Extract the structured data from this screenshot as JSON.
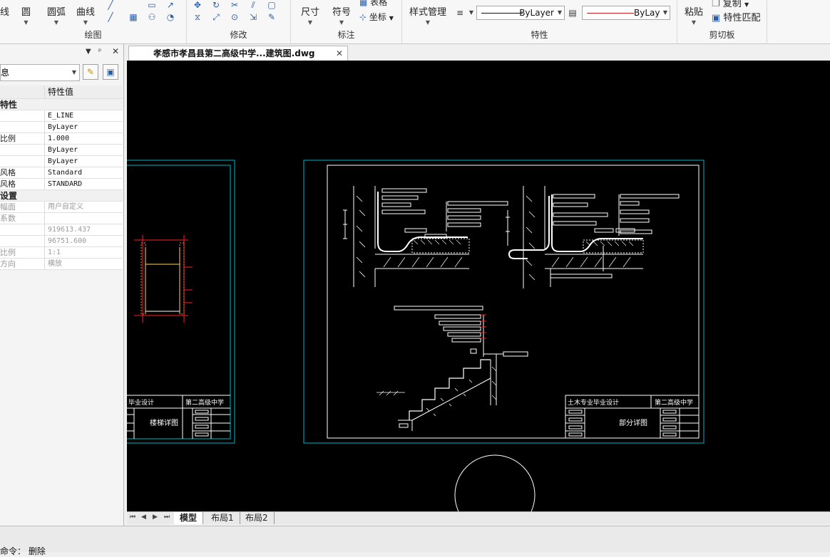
{
  "ribbon": {
    "draw": {
      "line_label": "线",
      "circle_label": "圆",
      "arc_label": "圆弧",
      "curve_label": "曲线",
      "group_label": "绘图"
    },
    "modify": {
      "group_label": "修改"
    },
    "annotate": {
      "dimension_label": "尺寸",
      "symbol_label": "符号",
      "table_label": "表格",
      "coordinate_label": "坐标",
      "group_label": "标注"
    },
    "properties": {
      "style_manager_label": "样式管理",
      "linetype_value": "ByLayer",
      "lineweight_value": "ByLayer",
      "group_label": "特性"
    },
    "clipboard": {
      "paste_label": "粘贴",
      "copy_label": "复制",
      "match_label": "特性匹配",
      "group_label": "剪切板"
    }
  },
  "props_panel": {
    "selector_value": "息",
    "header_key": "",
    "header_value": "特性值",
    "rows": [
      {
        "key": "特性",
        "value": "",
        "type": "cat"
      },
      {
        "key": "",
        "value": "E_LINE",
        "type": "row"
      },
      {
        "key": "",
        "value": "ByLayer",
        "type": "row"
      },
      {
        "key": "比例",
        "value": "1.000",
        "type": "row"
      },
      {
        "key": "",
        "value": "ByLayer",
        "type": "row"
      },
      {
        "key": "",
        "value": "ByLayer",
        "type": "row"
      },
      {
        "key": "风格",
        "value": "Standard",
        "type": "row"
      },
      {
        "key": "风格",
        "value": "STANDARD",
        "type": "row"
      },
      {
        "key": "设置",
        "value": "",
        "type": "cat"
      },
      {
        "key": "幅面",
        "value": "用户自定义",
        "type": "dis"
      },
      {
        "key": "系数",
        "value": "",
        "type": "dis"
      },
      {
        "key": "",
        "value": "919613.437",
        "type": "dis"
      },
      {
        "key": "",
        "value": "96751.600",
        "type": "dis"
      },
      {
        "key": "比例",
        "value": "1:1",
        "type": "dis"
      },
      {
        "key": "方向",
        "value": "横放",
        "type": "dis"
      }
    ]
  },
  "document": {
    "tab_title": "孝感市孝昌县第二高级中学...建筑图.dwg"
  },
  "drawing": {
    "left_sheet": {
      "design_label": "毕业设计",
      "school_label": "第二高级中学",
      "sheet_name": "楼梯详图"
    },
    "right_sheet": {
      "design_label": "土木专业毕业设计",
      "school_label": "第二高级中学",
      "sheet_name": "部分详图"
    }
  },
  "layout_tabs": {
    "model": "模型",
    "layout1": "布局1",
    "layout2": "布局2"
  },
  "command": {
    "text": "命令： 删除"
  },
  "colors": {
    "canvas": "#000000",
    "frame": "#00b4c8",
    "drawing": "#ffffff",
    "highlight": "#ff2020",
    "accent_yellow": "#ffd84a"
  }
}
